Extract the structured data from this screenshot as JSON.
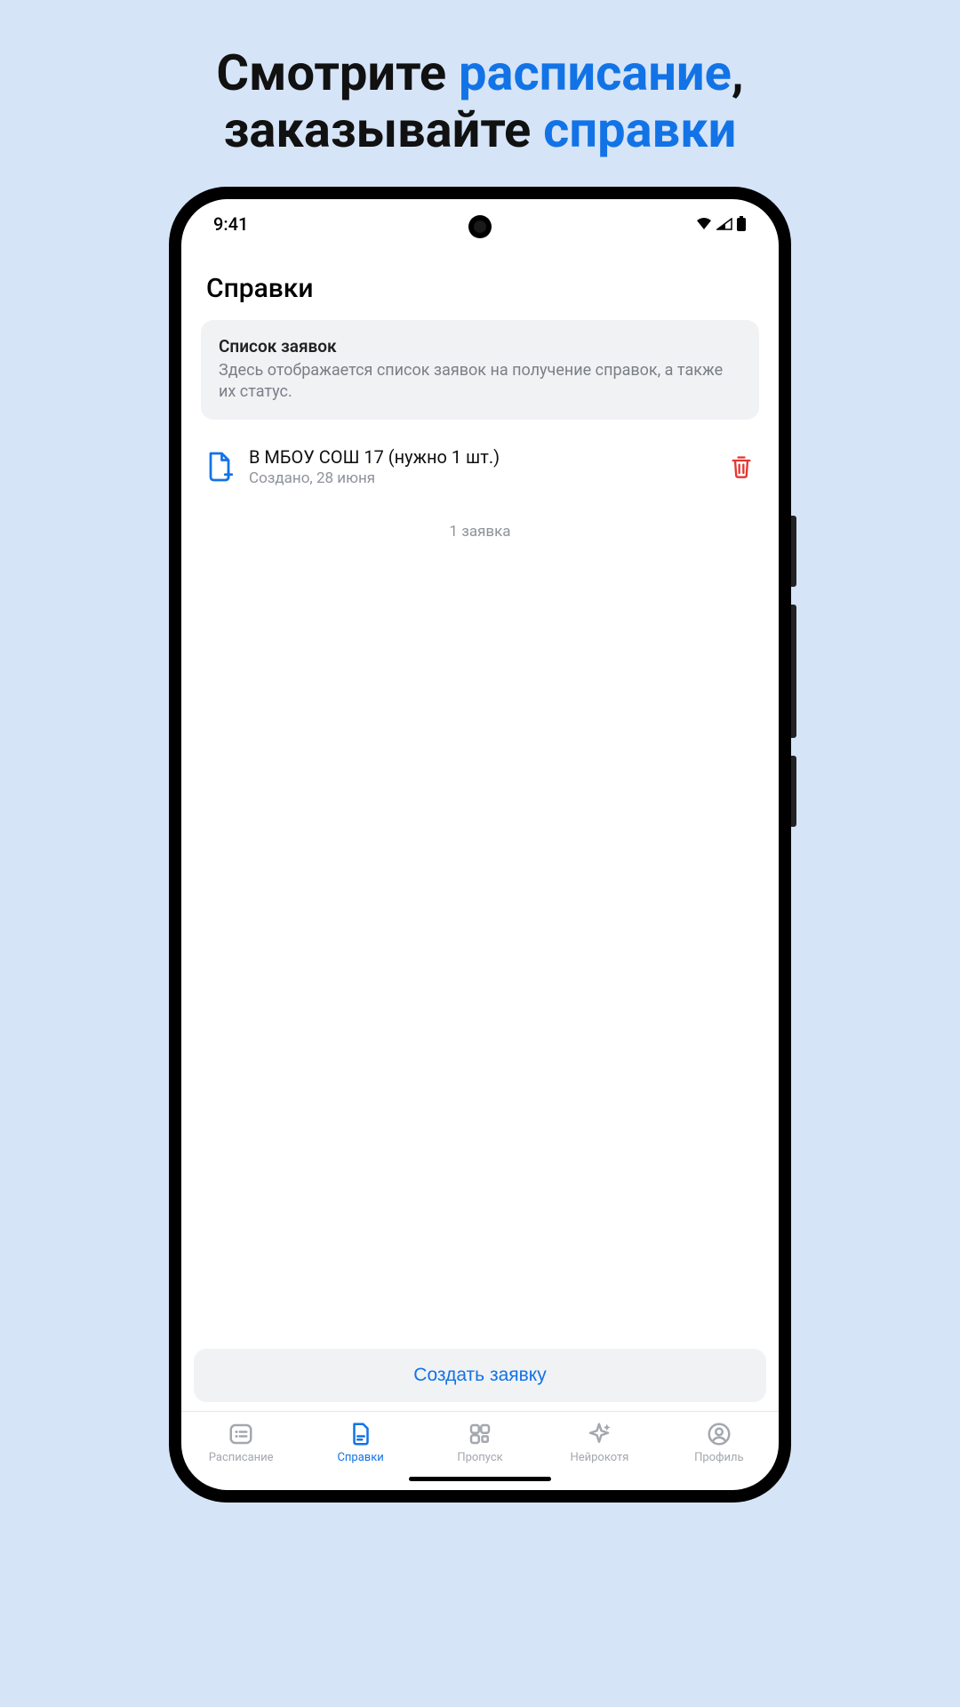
{
  "headline": {
    "part1": "Смотрите ",
    "accent1": "расписание",
    "part2": ",\nзаказывайте ",
    "accent2": "справки"
  },
  "status": {
    "time": "9:41"
  },
  "page": {
    "title": "Справки"
  },
  "info": {
    "title": "Список заявок",
    "desc": "Здесь отображается список заявок на получение справок, а также их статус."
  },
  "request": {
    "title": "В МБОУ СОШ 17 (нужно 1 шт.)",
    "sub": "Создано, 28 июня"
  },
  "count_label": "1 заявка",
  "create_button": "Создать заявку",
  "nav": {
    "schedule": "Расписание",
    "certs": "Справки",
    "pass": "Пропуск",
    "neuro": "Нейрокотя",
    "profile": "Профиль"
  }
}
